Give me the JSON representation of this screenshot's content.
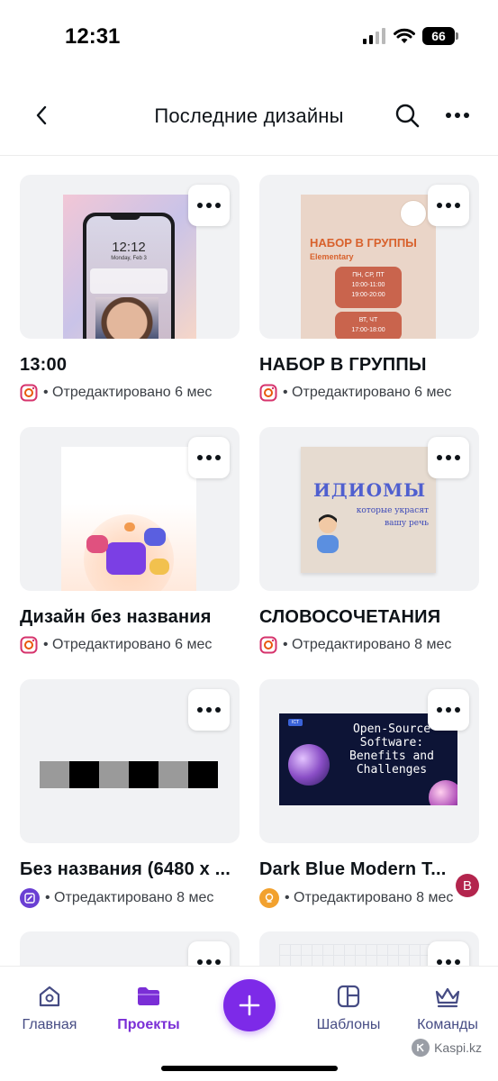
{
  "status_bar": {
    "time": "12:31",
    "battery": "66",
    "icons": [
      "signal-icon",
      "wifi-icon",
      "battery-icon"
    ]
  },
  "header": {
    "title": "Последние дизайны",
    "icons": [
      "back-icon",
      "search-icon",
      "more-icon"
    ]
  },
  "designs": [
    {
      "title": "13:00",
      "meta": "• Отредактировано 6 мес",
      "badge": "instagram"
    },
    {
      "title": "НАБОР В ГРУППЫ",
      "meta": "• Отредактировано 6 мес",
      "badge": "instagram",
      "thumb": {
        "heading": "НАБОР В ГРУППЫ",
        "sub": "Elementary",
        "days1": "ПН, СР, ПТ",
        "time1a": "10:00-11:00",
        "time1b": "19:00-20:00",
        "days2": "ВТ, ЧТ",
        "time2": "17:00-18:00"
      }
    },
    {
      "title": "Дизайн без названия",
      "meta": "• Отредактировано 6 мес",
      "badge": "instagram"
    },
    {
      "title": "СЛОВОСОЧЕТАНИЯ",
      "meta": "• Отредактировано 8 мес",
      "badge": "instagram",
      "thumb": {
        "heading": "ИДИОМЫ",
        "sub1": "которые украсят",
        "sub2": "вашу речь"
      }
    },
    {
      "title": "Без названия (6480 x ...",
      "meta": "• Отредактировано 8 мес",
      "badge": "edit"
    },
    {
      "title": "Dark Blue Modern T...",
      "meta": "• Отредактировано 8 мес",
      "badge": "sticker",
      "owner_initial": "B",
      "thumb": {
        "text": "Open-Source Software: Benefits and Challenges"
      }
    }
  ],
  "phone_thumb": {
    "time": "12:12",
    "date": "Monday, Feb 3"
  },
  "bottom_nav": {
    "items": [
      {
        "label": "Главная",
        "icon": "home-icon"
      },
      {
        "label": "Проекты",
        "icon": "folder-icon"
      },
      {
        "label": "Шаблоны",
        "icon": "templates-icon"
      },
      {
        "label": "Команды",
        "icon": "crown-icon"
      }
    ],
    "fab_icon": "plus-icon"
  },
  "watermark": "Kaspi.kz",
  "colors": {
    "accent": "#7d2ae8",
    "nav_active": "#7a2ed6",
    "nav_inactive": "#464c84",
    "card_bg": "#f1f2f4"
  }
}
